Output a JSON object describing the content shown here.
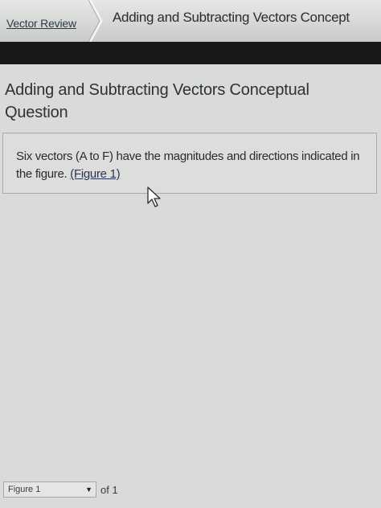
{
  "breadcrumb": {
    "parent": "Vector Review",
    "current": "Adding and Subtracting Vectors Concept"
  },
  "page": {
    "title": "Adding and Subtracting Vectors Conceptual Question"
  },
  "question": {
    "text": "Six vectors (A to F) have the magnitudes and directions indicated in the figure.",
    "link": "(Figure 1)"
  },
  "figure_nav": {
    "selected": "Figure 1",
    "of_label": "of 1"
  }
}
